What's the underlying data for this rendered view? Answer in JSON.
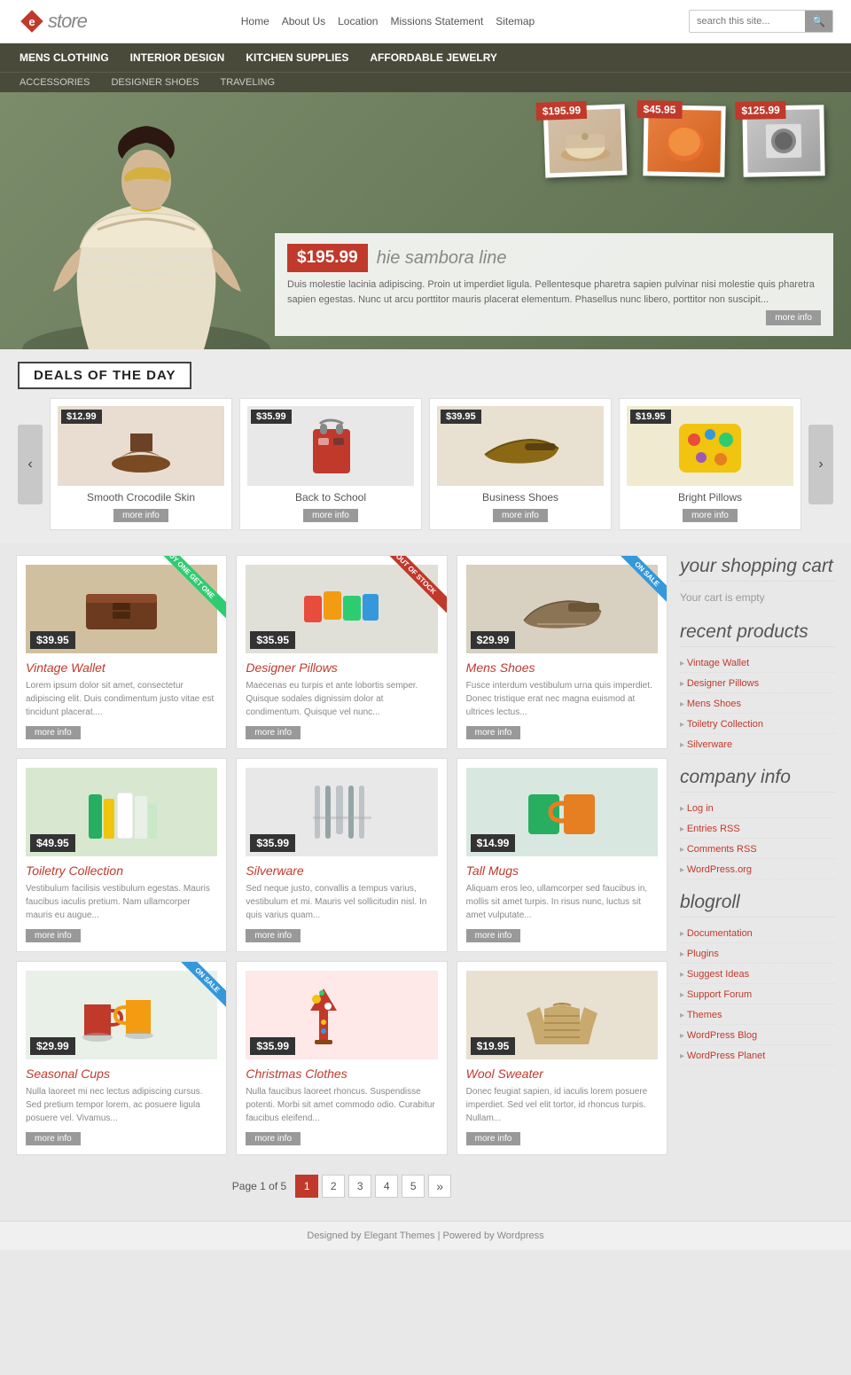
{
  "header": {
    "logo": "estore",
    "nav": [
      "Home",
      "About Us",
      "Location",
      "Missions Statement",
      "Sitemap"
    ],
    "search_placeholder": "search this site..."
  },
  "navbar": {
    "main_items": [
      "MENS CLOTHING",
      "INTERIOR DESIGN",
      "KITCHEN SUPPLIES",
      "AFFORDABLE JEWELRY"
    ],
    "sub_items": [
      "ACCESSORIES",
      "DESIGNER SHOES",
      "TRAVELING"
    ]
  },
  "hero": {
    "product1_price": "$195.99",
    "product2_price": "$45.95",
    "product3_price": "$125.99",
    "info_price": "$195.99",
    "info_title": "hie sambora line",
    "info_desc": "Duis molestie lacinia adipiscing. Proin ut imperdiet ligula. Pellentesque pharetra sapien pulvinar nisi molestie quis pharetra sapien egestas. Nunc ut arcu porttitor mauris placerat elementum. Phasellus nunc libero, porttitor non suscipit...",
    "more_info": "more info"
  },
  "deals": {
    "title": "DEALS OF THE DAY",
    "items": [
      {
        "name": "Smooth Crocodile Skin",
        "price": "$12.99"
      },
      {
        "name": "Back to School",
        "price": "$35.99"
      },
      {
        "name": "Business Shoes",
        "price": "$39.95"
      },
      {
        "name": "Bright Pillows",
        "price": "$19.95"
      }
    ],
    "more_info": "more info"
  },
  "products": [
    {
      "name": "Vintage Wallet",
      "price": "$39.95",
      "ribbon": "BUY ONE GET ONE",
      "ribbon_color": "green",
      "desc": "Lorem ipsum dolor sit amet, consectetur adipiscing elit. Duis condimentum justo vitae est tincidunt placerat...."
    },
    {
      "name": "Designer Pillows",
      "price": "$35.95",
      "ribbon": "OUT OF STOCK",
      "ribbon_color": "red",
      "desc": "Maecenas eu turpis et ante lobortis semper. Quisque sodales dignissim dolor at condimentum. Quisque vel nunc..."
    },
    {
      "name": "Mens Shoes",
      "price": "$29.99",
      "ribbon": "ON SALE",
      "ribbon_color": "blue",
      "desc": "Fusce interdum vestibulum urna quis imperdiet. Donec tristique erat nec magna euismod at ultrices lectus..."
    },
    {
      "name": "Toiletry Collection",
      "price": "$49.95",
      "ribbon": "",
      "ribbon_color": "",
      "desc": "Vestibulum facilisis vestibulum egestas. Mauris faucibus iaculis pretium. Nam ullamcorper mauris eu augue..."
    },
    {
      "name": "Silverware",
      "price": "$35.99",
      "ribbon": "",
      "ribbon_color": "",
      "desc": "Sed neque justo, convallis a tempus varius, vestibulum et mi. Mauris vel sollicitudin nisl. In quis varius quam..."
    },
    {
      "name": "Tall Mugs",
      "price": "$14.99",
      "ribbon": "",
      "ribbon_color": "",
      "desc": "Aliquam eros leo, ullamcorper sed faucibus in, mollis sit amet turpis. In risus nunc, luctus sit amet vulputate..."
    },
    {
      "name": "Seasonal Cups",
      "price": "$29.99",
      "ribbon": "ON SALE",
      "ribbon_color": "blue",
      "desc": "Nulla laoreet mi nec lectus adipiscing cursus. Sed pretium tempor lorem, ac posuere ligula posuere vel. Vivamus..."
    },
    {
      "name": "Christmas Clothes",
      "price": "$35.99",
      "ribbon": "",
      "ribbon_color": "",
      "desc": "Nulla faucibus laoreet rhoncus. Suspendisse potenti. Morbi sit amet commodo odio. Curabitur faucibus eleifend..."
    },
    {
      "name": "Wool Sweater",
      "price": "$19.95",
      "ribbon": "",
      "ribbon_color": "",
      "desc": "Donec feugiat sapien, id iaculis lorem posuere imperdiet. Sed vel elit tortor, id rhoncus turpis. Nullam..."
    }
  ],
  "more_info_label": "more info",
  "sidebar": {
    "cart_title": "your shopping cart",
    "cart_empty": "Your cart is empty",
    "recent_title": "recent products",
    "recent_items": [
      "Vintage Wallet",
      "Designer Pillows",
      "Mens Shoes",
      "Toiletry Collection",
      "Silverware"
    ],
    "company_title": "company info",
    "company_items": [
      "Log in",
      "Entries RSS",
      "Comments RSS",
      "WordPress.org"
    ],
    "blogroll_title": "blogroll",
    "blogroll_items": [
      "Documentation",
      "Plugins",
      "Suggest Ideas",
      "Support Forum",
      "Themes",
      "WordPress Blog",
      "WordPress Planet"
    ]
  },
  "pagination": {
    "label": "Page 1 of 5",
    "pages": [
      "1",
      "2",
      "3",
      "4",
      "5"
    ],
    "next": "»"
  },
  "footer": {
    "text": "Designed by",
    "link1": "Elegant Themes",
    "separator": " | Powered by ",
    "link2": "Wordpress"
  }
}
